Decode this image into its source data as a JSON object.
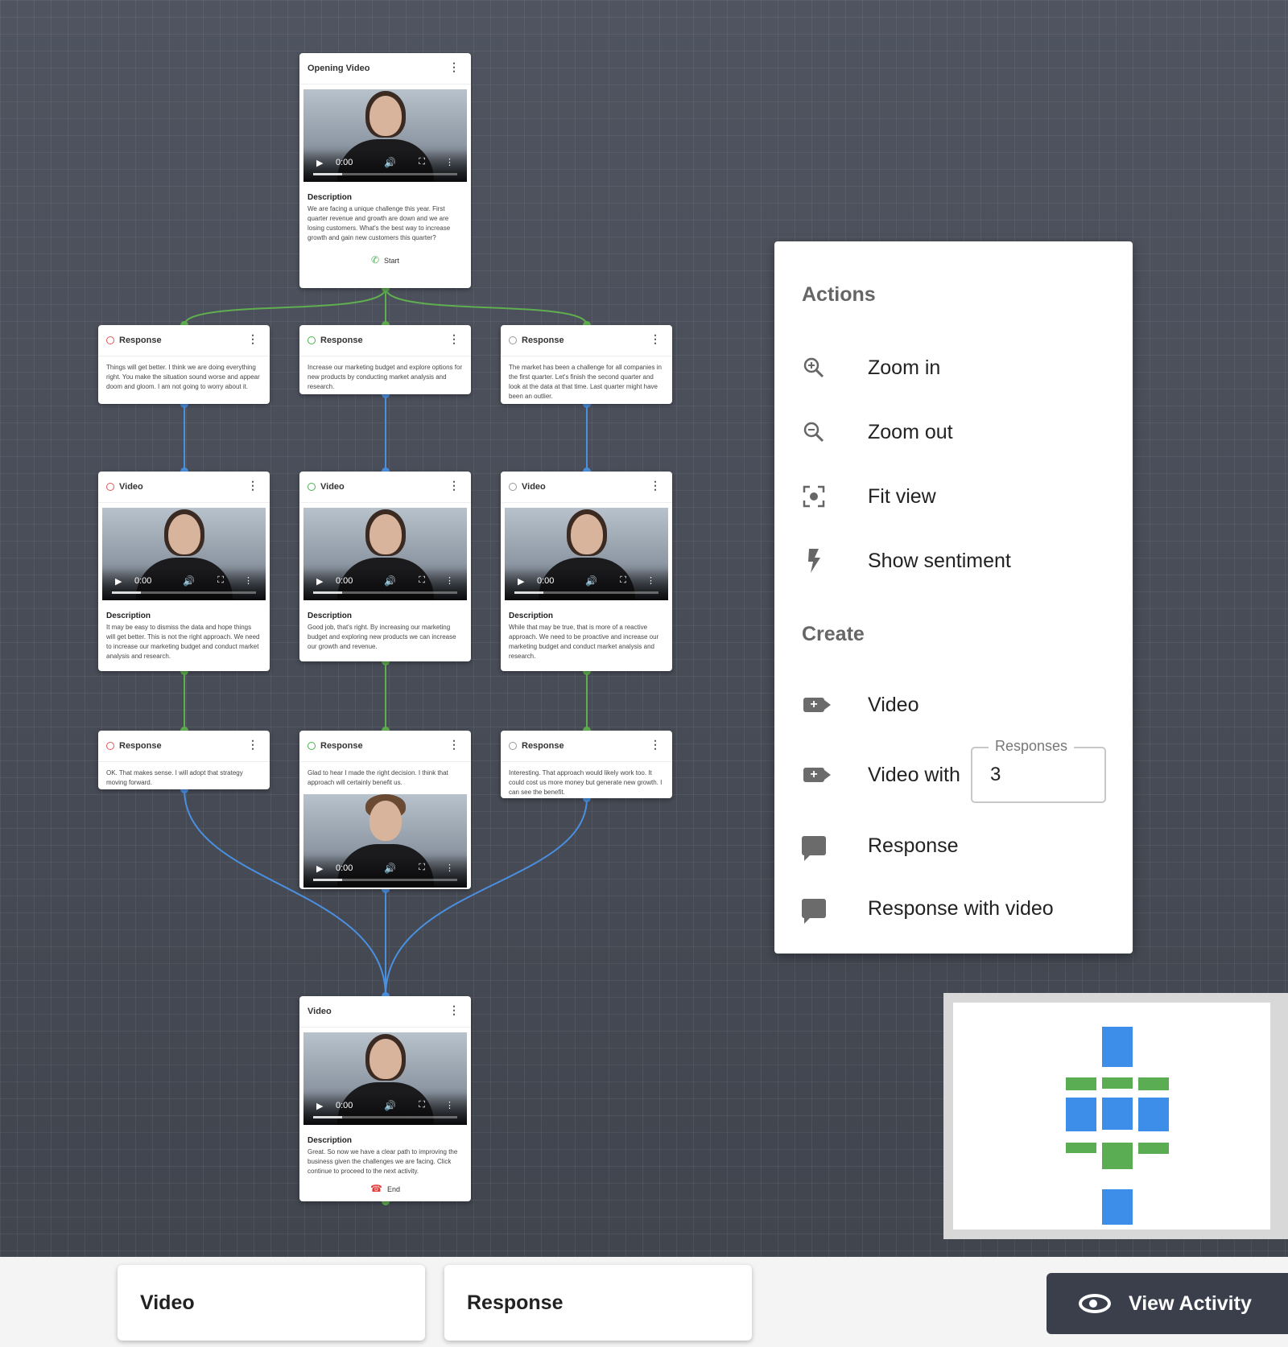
{
  "nodes": {
    "opening": {
      "title": "Opening Video",
      "time": "0:00",
      "desc_title": "Description",
      "desc": "We are facing a unique challenge this year. First quarter revenue and growth are down and we are losing customers. What's the best way to increase growth and gain new customers this quarter?",
      "footer": "Start"
    },
    "resp1": {
      "title": "Response",
      "sentiment": "negative",
      "text": "Things will get better. I think we are doing everything right. You make the situation sound worse and appear doom and gloom. I am not going to worry about it."
    },
    "resp2": {
      "title": "Response",
      "sentiment": "positive",
      "text": "Increase our marketing budget and explore options for new products by conducting market analysis and research."
    },
    "resp3": {
      "title": "Response",
      "sentiment": "neutral",
      "text": "The market has been a challenge for all companies in the first quarter. Let's finish the second quarter and look at the data at that time. Last quarter might have been an outlier."
    },
    "video1": {
      "title": "Video",
      "sentiment": "negative",
      "time": "0:00",
      "desc_title": "Description",
      "desc": "It may be easy to dismiss the data and hope things will get better. This is not the right approach. We need to increase our marketing budget and conduct market analysis and research."
    },
    "video2": {
      "title": "Video",
      "sentiment": "positive",
      "time": "0:00",
      "desc_title": "Description",
      "desc": "Good job, that's right. By increasing our marketing budget and exploring new products we can increase our growth and revenue."
    },
    "video3": {
      "title": "Video",
      "sentiment": "neutral",
      "time": "0:00",
      "desc_title": "Description",
      "desc": "While that may be true, that is more of a reactive approach. We need to be proactive and increase our marketing budget and conduct market analysis and research."
    },
    "resp4": {
      "title": "Response",
      "sentiment": "negative",
      "text": "OK. That makes sense. I will adopt that strategy moving forward."
    },
    "resp5": {
      "title": "Response",
      "sentiment": "positive",
      "text": "Glad to hear I made the right decision. I think that approach will certainly benefit us.",
      "time": "0:00"
    },
    "resp6": {
      "title": "Response",
      "sentiment": "neutral",
      "text": "Interesting. That approach would likely work too. It could cost us more money but generate new growth. I can see the benefit."
    },
    "final": {
      "title": "Video",
      "time": "0:00",
      "desc_title": "Description",
      "desc": "Great. So now we have a clear path to improving the business given the challenges we are facing. Click continue to proceed to the next activity.",
      "footer": "End"
    }
  },
  "panel": {
    "actions_title": "Actions",
    "zoom_in": "Zoom in",
    "zoom_out": "Zoom out",
    "fit_view": "Fit view",
    "show_sentiment": "Show sentiment",
    "create_title": "Create",
    "video": "Video",
    "video_with": "Video with",
    "responses_label": "Responses",
    "responses_value": "3",
    "response": "Response",
    "response_with_video": "Response with video"
  },
  "bottom": {
    "video_card": "Video",
    "response_card": "Response",
    "view_activity": "View Activity"
  },
  "colors": {
    "edge_green": "#5fae4f",
    "edge_blue": "#4a8fe0",
    "minimap_blue": "#3d8ee8",
    "minimap_green": "#5aad52",
    "sentiment_negative": "#e05757",
    "sentiment_positive": "#4caf50",
    "sentiment_neutral": "#999999"
  },
  "icons": {
    "zoom_in": "zoom-in-icon",
    "zoom_out": "zoom-out-icon",
    "fit_view": "fit-view-icon",
    "show_sentiment": "lightning-icon",
    "video": "video-plus-icon",
    "response": "chat-bubble-icon",
    "view_activity": "eye-icon"
  }
}
